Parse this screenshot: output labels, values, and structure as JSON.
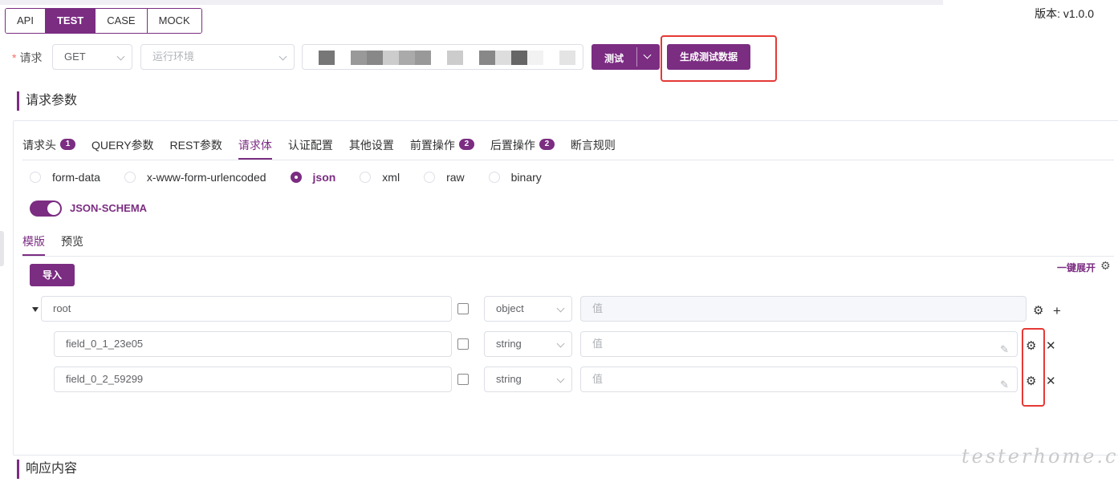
{
  "version": "版本: v1.0.0",
  "mode_tabs": [
    {
      "label": "API"
    },
    {
      "label": "TEST"
    },
    {
      "label": "CASE"
    },
    {
      "label": "MOCK"
    }
  ],
  "request": {
    "label": "请求",
    "method": "GET",
    "env_placeholder": "运行环境",
    "test_button": "测试",
    "generate_button": "生成测试数据"
  },
  "sections": {
    "request_params": "请求参数",
    "response": "响应内容"
  },
  "param_tabs": [
    {
      "label": "请求头",
      "badge": "1"
    },
    {
      "label": "QUERY参数",
      "badge": ""
    },
    {
      "label": "REST参数",
      "badge": ""
    },
    {
      "label": "请求体",
      "badge": ""
    },
    {
      "label": "认证配置",
      "badge": ""
    },
    {
      "label": "其他设置",
      "badge": ""
    },
    {
      "label": "前置操作",
      "badge": "2"
    },
    {
      "label": "后置操作",
      "badge": "2"
    },
    {
      "label": "断言规则",
      "badge": ""
    }
  ],
  "body_types": [
    "form-data",
    "x-www-form-urlencoded",
    "json",
    "xml",
    "raw",
    "binary"
  ],
  "json_schema_label": "JSON-SCHEMA",
  "sub_tabs": [
    "模版",
    "预览"
  ],
  "import_button": "导入",
  "expand_all": "一键展开",
  "schema_rows": [
    {
      "name": "root",
      "type": "object",
      "value_placeholder": "值"
    },
    {
      "name": "field_0_1_23e05",
      "type": "string",
      "value_placeholder": "值"
    },
    {
      "name": "field_0_2_59299",
      "type": "string",
      "value_placeholder": "值"
    }
  ],
  "watermark": "testerhome.com",
  "colors": {
    "brand": "#7b2d82",
    "highlight_box": "#e53935"
  }
}
